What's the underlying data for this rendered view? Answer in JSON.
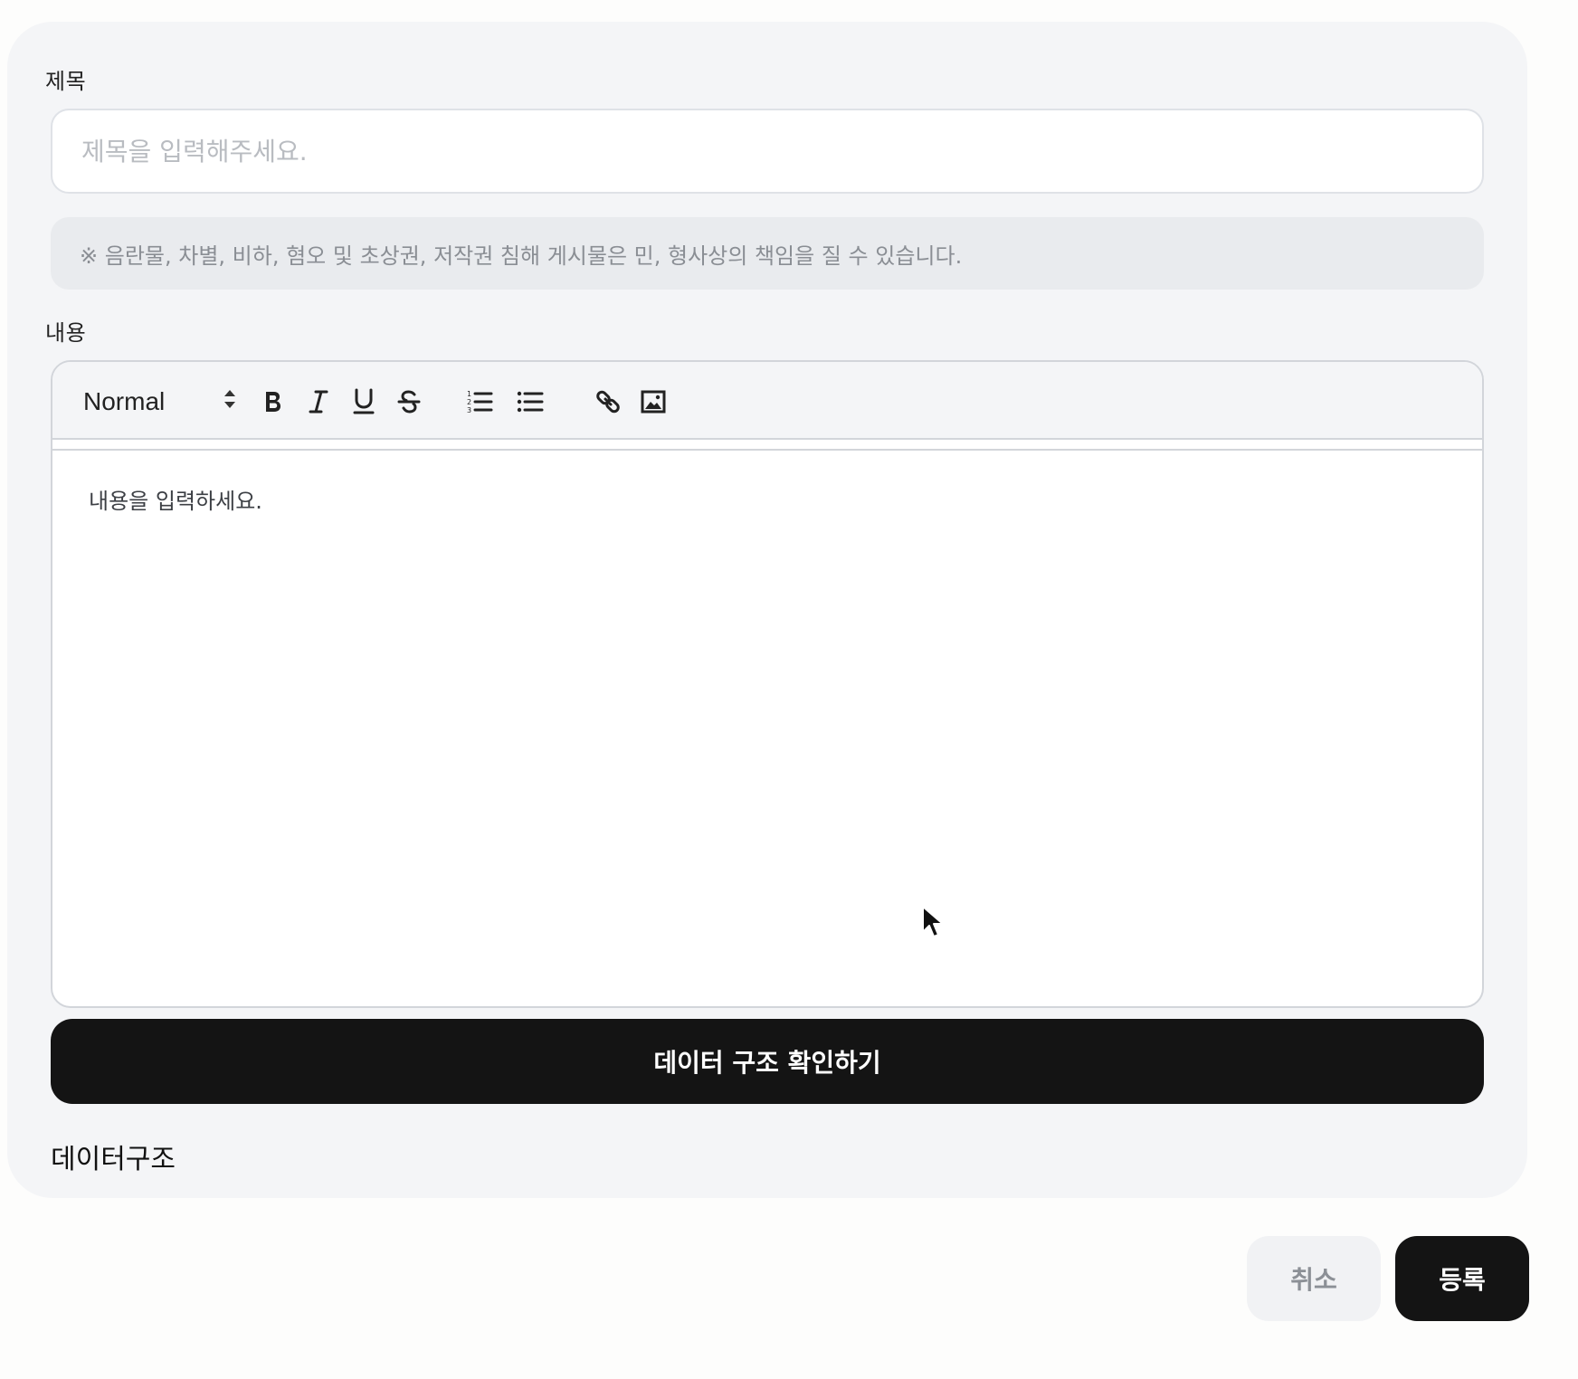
{
  "form": {
    "title_label": "제목",
    "title_placeholder": "제목을 입력해주세요.",
    "title_value": "",
    "notice": "※ 음란물, 차별, 비하, 혐오 및 초상권, 저작권 침해 게시물은 민, 형사상의 책임을 질 수 있습니다.",
    "content_label": "내용",
    "content_placeholder": "내용을 입력하세요."
  },
  "toolbar": {
    "format_value": "Normal",
    "icons": [
      "updown-arrows-icon",
      "bold-icon",
      "italic-icon",
      "underline-icon",
      "strike-icon",
      "ordered-list-icon",
      "bullet-list-icon",
      "link-icon",
      "image-icon"
    ]
  },
  "actions": {
    "check_structure_label": "데이터 구조 확인하기",
    "data_heading": "데이터구조",
    "cancel_label": "취소",
    "submit_label": "등록"
  },
  "colors": {
    "card_bg": "#f4f5f7",
    "dark_button": "#141414",
    "notice_bg": "#e9ebee",
    "placeholder": "#b9bcc1"
  }
}
